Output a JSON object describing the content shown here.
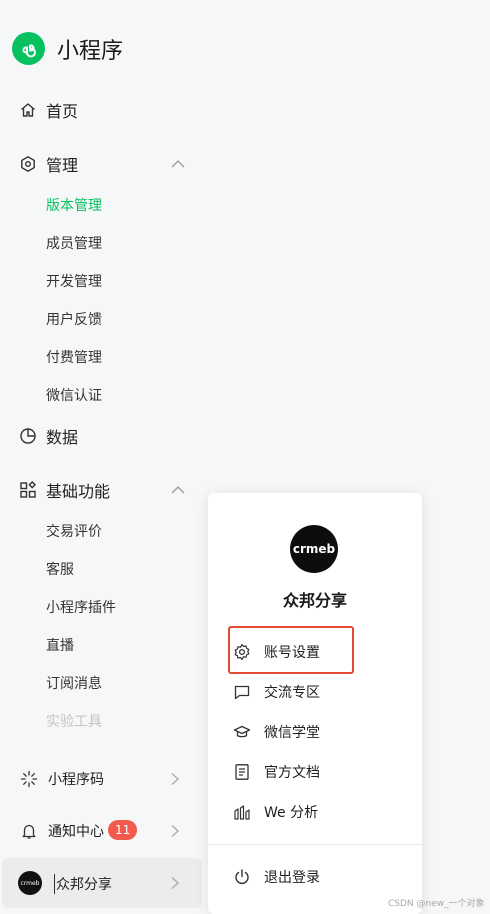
{
  "brand": {
    "title": "小程序"
  },
  "nav": {
    "home": "首页",
    "manage": "管理",
    "manage_items": [
      "版本管理",
      "成员管理",
      "开发管理",
      "用户反馈",
      "付费管理",
      "微信认证"
    ],
    "data": "数据",
    "basic": "基础功能",
    "basic_items": [
      "交易评价",
      "客服",
      "小程序插件",
      "直播",
      "订阅消息",
      "实验工具"
    ]
  },
  "bottom": {
    "qrcode": "小程序码",
    "notify": "通知中心",
    "notify_count": "11",
    "account": "众邦分享"
  },
  "popup": {
    "avatar_text": "crmeb",
    "name": "众邦分享",
    "items": [
      "账号设置",
      "交流专区",
      "微信学堂",
      "官方文档",
      "We 分析"
    ],
    "logout": "退出登录"
  },
  "watermark": "CSDN @new_一个对象",
  "colors": {
    "accent": "#07c160",
    "badge": "#f25a4e",
    "highlight": "#e44a36"
  }
}
